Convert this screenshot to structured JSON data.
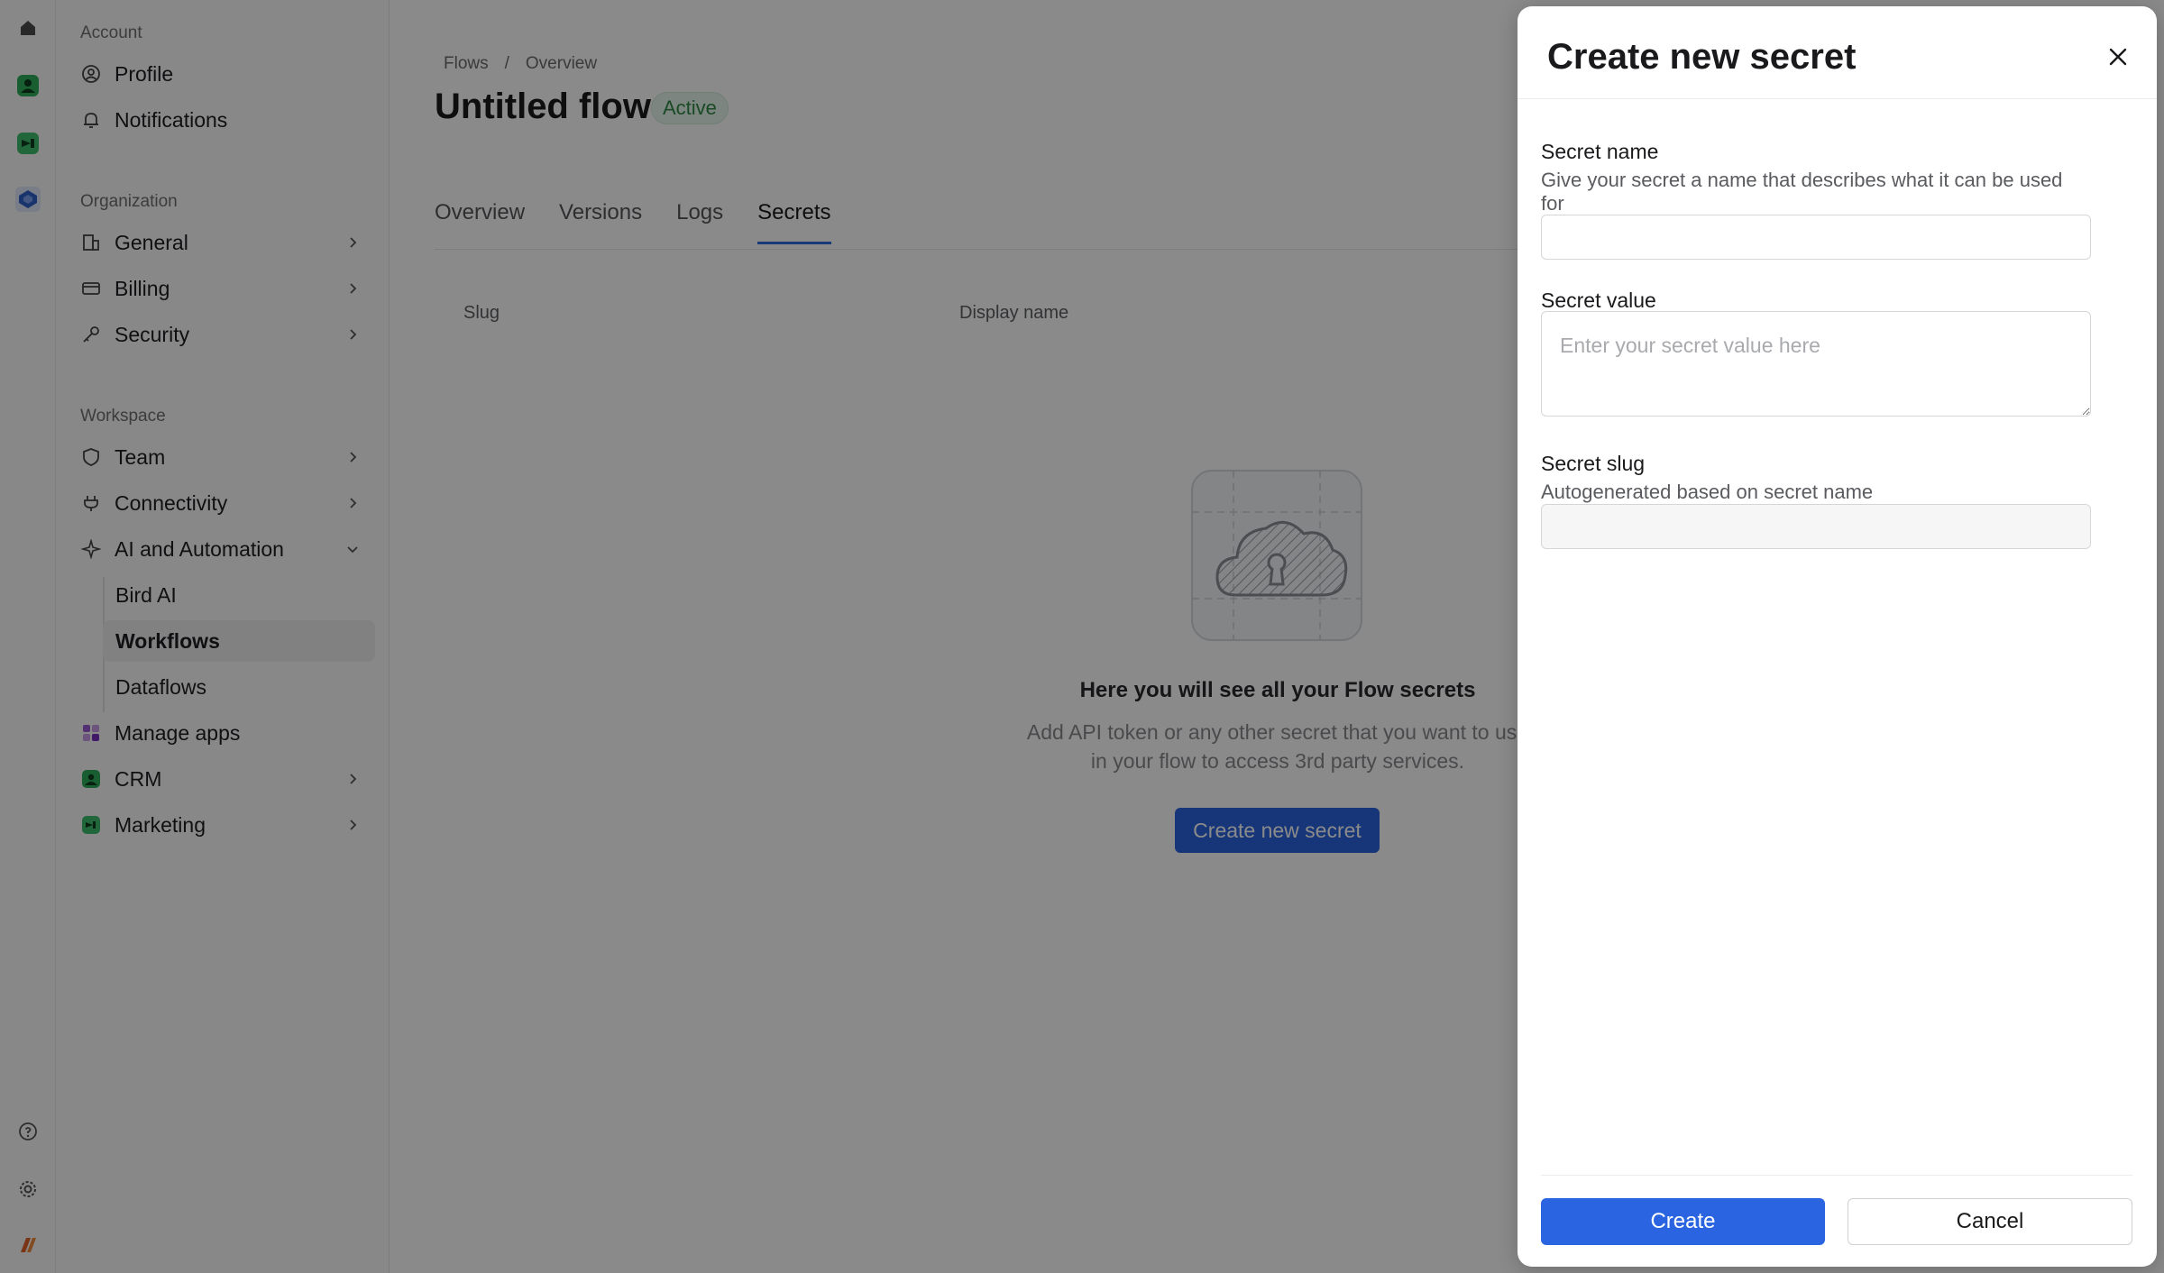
{
  "rail": {
    "icons": [
      "home-icon",
      "crm-app-icon",
      "marketing-app-icon",
      "workspace-app-icon",
      "help-icon",
      "settings-icon",
      "brand-logo-icon"
    ]
  },
  "sidebar": {
    "account_label": "Account",
    "account_items": [
      {
        "label": "Profile",
        "icon": "user-circle-icon"
      },
      {
        "label": "Notifications",
        "icon": "bell-icon"
      }
    ],
    "organization_label": "Organization",
    "organization_items": [
      {
        "label": "General",
        "icon": "building-icon"
      },
      {
        "label": "Billing",
        "icon": "credit-card-icon"
      },
      {
        "label": "Security",
        "icon": "key-icon"
      }
    ],
    "workspace_label": "Workspace",
    "workspace_items": [
      {
        "label": "Team",
        "icon": "shield-icon"
      },
      {
        "label": "Connectivity",
        "icon": "plug-icon"
      },
      {
        "label": "AI and Automation",
        "icon": "sparkle-icon"
      }
    ],
    "ai_sub_items": [
      "Bird AI",
      "Workflows",
      "Dataflows"
    ],
    "active_sub_item": "Workflows",
    "bottom_items": [
      {
        "label": "Manage apps",
        "icon": "apps-icon"
      },
      {
        "label": "CRM",
        "icon": "crm-icon"
      },
      {
        "label": "Marketing",
        "icon": "marketing-icon"
      }
    ]
  },
  "main": {
    "breadcrumb": [
      "Flows",
      "/",
      "Overview"
    ],
    "title": "Untitled flow",
    "status_badge": "Active",
    "tabs": [
      "Overview",
      "Versions",
      "Logs",
      "Secrets"
    ],
    "active_tab": "Secrets",
    "columns": [
      "Slug",
      "Display name"
    ],
    "empty_state": {
      "title": "Here you will see all your Flow secrets",
      "description": "Add API token or any other secret that you want to use in your flow to access 3rd party services.",
      "button": "Create new secret"
    }
  },
  "drawer": {
    "title": "Create new secret",
    "secret_name": {
      "label": "Secret name",
      "help": "Give your secret a name that describes what it can be used for",
      "value": "",
      "placeholder": ""
    },
    "secret_value": {
      "label": "Secret value",
      "value": "",
      "placeholder": "Enter your secret value here"
    },
    "secret_slug": {
      "label": "Secret slug",
      "help": "Autogenerated based on secret name",
      "value": ""
    },
    "create_button": "Create",
    "cancel_button": "Cancel"
  },
  "colors": {
    "accent": "#2b64e0",
    "active_badge_bg": "#e6f5ea",
    "active_badge_text": "#2f8a47",
    "overlay": "rgba(0,0,0,0.46)"
  }
}
